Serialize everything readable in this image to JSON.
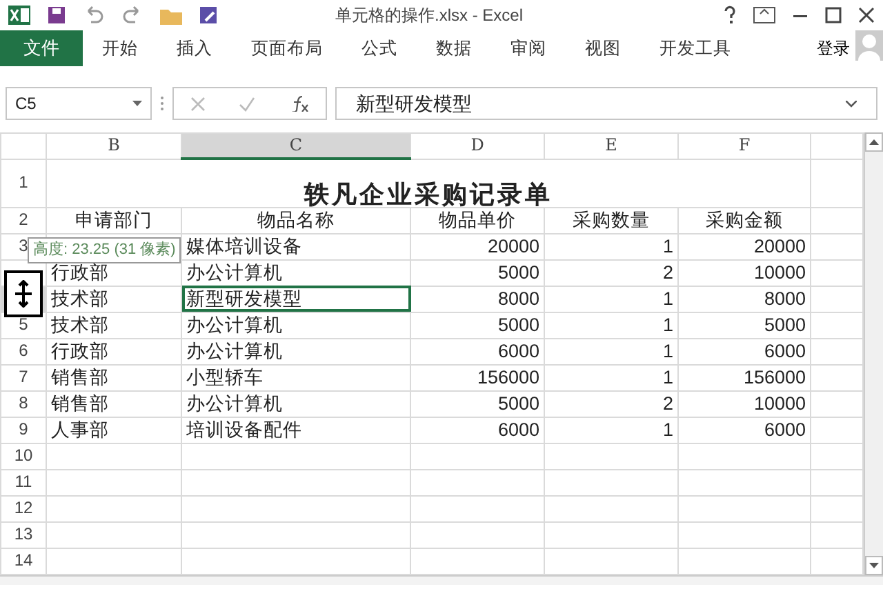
{
  "window": {
    "title": "单元格的操作.xlsx - Excel"
  },
  "ribbon": {
    "file_tab": "文件",
    "tabs": [
      {
        "label": "开始",
        "selected": false
      },
      {
        "label": "插入",
        "selected": false
      },
      {
        "label": "页面布局",
        "selected": false
      },
      {
        "label": "公式",
        "selected": false
      },
      {
        "label": "数据",
        "selected": false
      },
      {
        "label": "审阅",
        "selected": false
      },
      {
        "label": "视图",
        "selected": false
      },
      {
        "label": "开发工具",
        "selected": false
      }
    ],
    "account": "登录"
  },
  "formula_bar": {
    "name_box": "C5",
    "formula": "新型研发模型"
  },
  "columns": [
    {
      "label": "B",
      "selected": false
    },
    {
      "label": "C",
      "selected": true
    },
    {
      "label": "D",
      "selected": false
    },
    {
      "label": "E",
      "selected": false
    },
    {
      "label": "F",
      "selected": false
    }
  ],
  "rows": [
    {
      "header": "1",
      "kind": "title",
      "cells": [
        "轶凡企业采购记录单"
      ],
      "active": false
    },
    {
      "header": "2",
      "kind": "header",
      "cells": [
        "申请部门",
        "物品名称",
        "物品单价",
        "采购数量",
        "采购金额"
      ],
      "active": false
    },
    {
      "header": "3",
      "kind": "data",
      "cells": [
        "",
        "媒体培训设备",
        "20000",
        "1",
        "20000"
      ],
      "active": false
    },
    {
      "kind": "data",
      "cells": [
        "行政部",
        "办公计算机",
        "5000",
        "2",
        "10000"
      ],
      "active": false
    },
    {
      "kind": "data",
      "cells": [
        "技术部",
        "新型研发模型",
        "8000",
        "1",
        "8000"
      ],
      "active": true
    },
    {
      "header": "5",
      "kind": "data",
      "cells": [
        "技术部",
        "办公计算机",
        "5000",
        "1",
        "5000"
      ],
      "active": false
    },
    {
      "header": "6",
      "kind": "data",
      "cells": [
        "行政部",
        "办公计算机",
        "6000",
        "1",
        "6000"
      ],
      "active": false
    },
    {
      "header": "7",
      "kind": "data",
      "cells": [
        "销售部",
        "小型轿车",
        "156000",
        "1",
        "156000"
      ],
      "active": false
    },
    {
      "header": "8",
      "kind": "data",
      "cells": [
        "销售部",
        "办公计算机",
        "5000",
        "2",
        "10000"
      ],
      "active": false
    },
    {
      "header": "9",
      "kind": "data",
      "cells": [
        "人事部",
        "培训设备配件",
        "6000",
        "1",
        "6000"
      ],
      "active": false
    },
    {
      "header": "10",
      "kind": "empty",
      "cells": [],
      "active": false
    },
    {
      "header": "11",
      "kind": "empty",
      "cells": [],
      "active": false
    },
    {
      "header": "12",
      "kind": "empty",
      "cells": [],
      "active": false
    },
    {
      "header": "13",
      "kind": "empty",
      "cells": [],
      "active": false
    },
    {
      "header": "14",
      "kind": "empty",
      "cells": [],
      "active": false
    }
  ],
  "tooltip": "高度: 23.25 (31 像素)"
}
